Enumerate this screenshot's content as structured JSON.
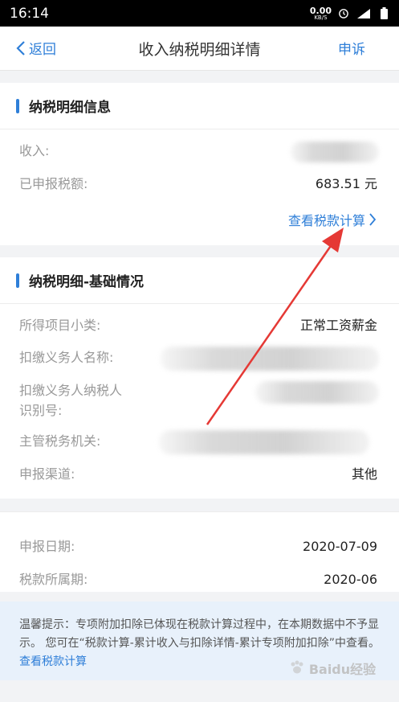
{
  "status": {
    "time": "16:14",
    "net_speed": "0.00",
    "net_unit": "KB/S",
    "signal": "4G",
    "icons": [
      "alarm-icon",
      "signal-icon",
      "battery-icon"
    ]
  },
  "nav": {
    "back_label": "返回",
    "title": "收入纳税明细详情",
    "appeal_label": "申诉"
  },
  "section1": {
    "title": "纳税明细信息",
    "rows": [
      {
        "label": "收入:",
        "value": ""
      },
      {
        "label": "已申报税额:",
        "value": "683.51 元"
      }
    ],
    "link": "查看税款计算"
  },
  "section2": {
    "title": "纳税明细-基础情况",
    "rows": [
      {
        "label": "所得项目小类:",
        "value": "正常工资薪金"
      },
      {
        "label": "扣缴义务人名称:",
        "value": ""
      },
      {
        "label": "扣缴义务人纳税人",
        "label2": "识别号:",
        "value": ""
      },
      {
        "label": "主管税务机关:",
        "value": ""
      },
      {
        "label": "申报渠道:",
        "value": "其他"
      }
    ]
  },
  "section3": {
    "rows": [
      {
        "label": "申报日期:",
        "value": "2020-07-09"
      },
      {
        "label": "税款所属期:",
        "value": "2020-06"
      }
    ]
  },
  "notice": {
    "text": "温馨提示：专项附加扣除已体现在税款计算过程中，在本期数据中不予显示。 您可在“税款计算-累计收入与扣除详情-累计专项附加扣除”中查看。",
    "link": "查看税款计算"
  },
  "watermark": "Baidu经验",
  "colors": {
    "accent": "#2f7fd8",
    "annotation": "#e53935",
    "notice_bg": "#e8f1fb"
  }
}
